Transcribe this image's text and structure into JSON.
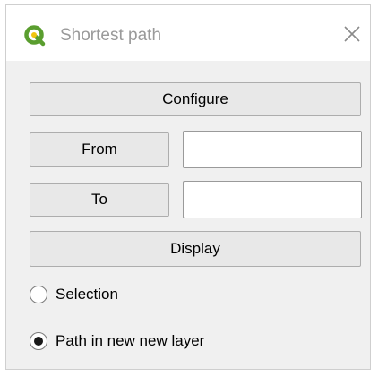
{
  "window": {
    "title": "Shortest path",
    "app_icon": "qgis-logo-icon",
    "close_icon": "close-icon"
  },
  "buttons": {
    "configure": "Configure",
    "from": "From",
    "to": "To",
    "display": "Display"
  },
  "fields": {
    "from_value": "",
    "to_value": ""
  },
  "output_options": [
    {
      "label": "Selection",
      "selected": false
    },
    {
      "label": "Path in new new layer",
      "selected": true
    }
  ],
  "colors": {
    "brand_green": "#5a9e2f",
    "brand_yellow": "#f1c40f",
    "title_gray": "#9a9a9a",
    "window_bg": "#f0f0f0"
  }
}
